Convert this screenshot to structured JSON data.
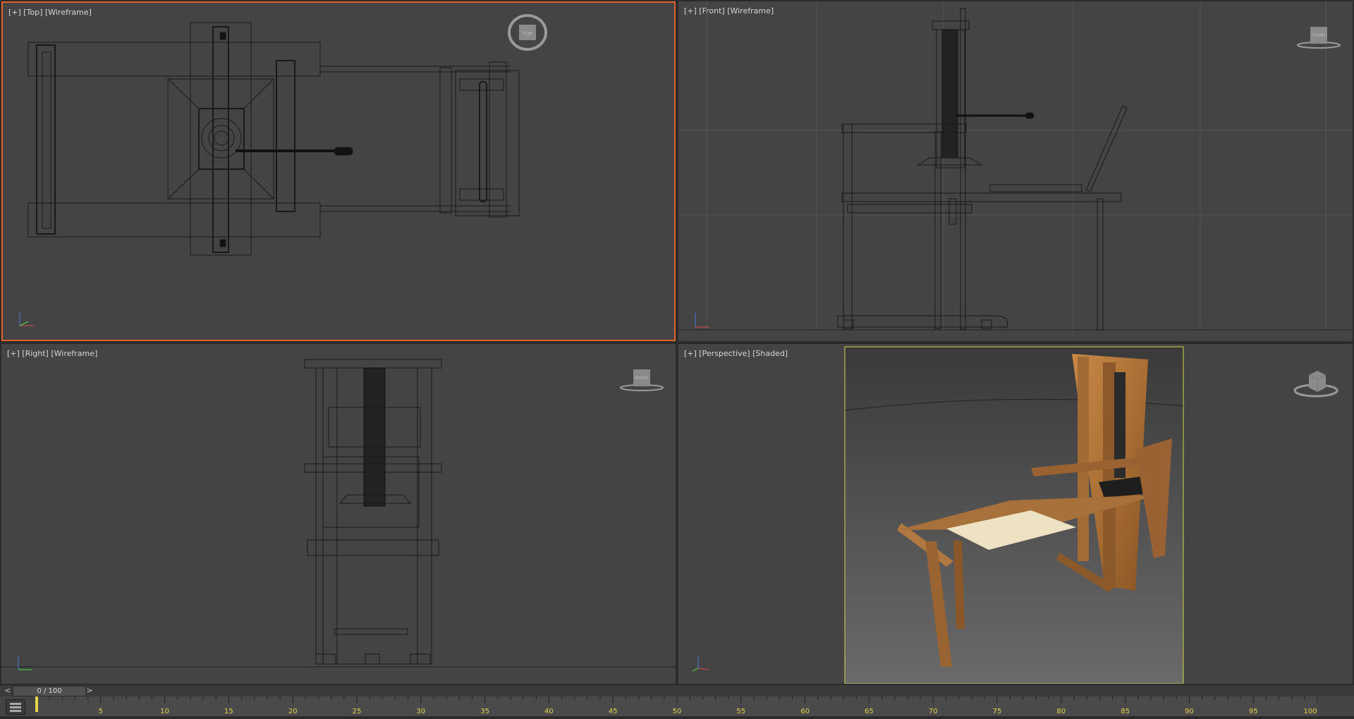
{
  "viewports": {
    "top": {
      "label": "[+] [Top] [Wireframe]",
      "cube_label": "TOP"
    },
    "front": {
      "label": "[+] [Front] [Wireframe]",
      "cube_label": "FRONT"
    },
    "right": {
      "label": "[+] [Right] [Wireframe]",
      "cube_label": "RIGHT"
    },
    "perspective": {
      "label": "[+] [Perspective] [Shaded]"
    }
  },
  "timeline": {
    "prev": "<",
    "frame_display": "0 / 100",
    "next": ">",
    "current_frame": 0,
    "total_frames": 100,
    "tick_labels": [
      "5",
      "10",
      "15",
      "20",
      "25",
      "30",
      "35",
      "40",
      "45",
      "50",
      "55",
      "60",
      "65",
      "70",
      "75",
      "80",
      "85",
      "90",
      "95",
      "100"
    ]
  },
  "colors": {
    "active_viewport_border": "#e0632d",
    "viewport_bg": "#444444",
    "tick_label": "#e6d24a",
    "perspective_frame": "#d4d44a"
  }
}
